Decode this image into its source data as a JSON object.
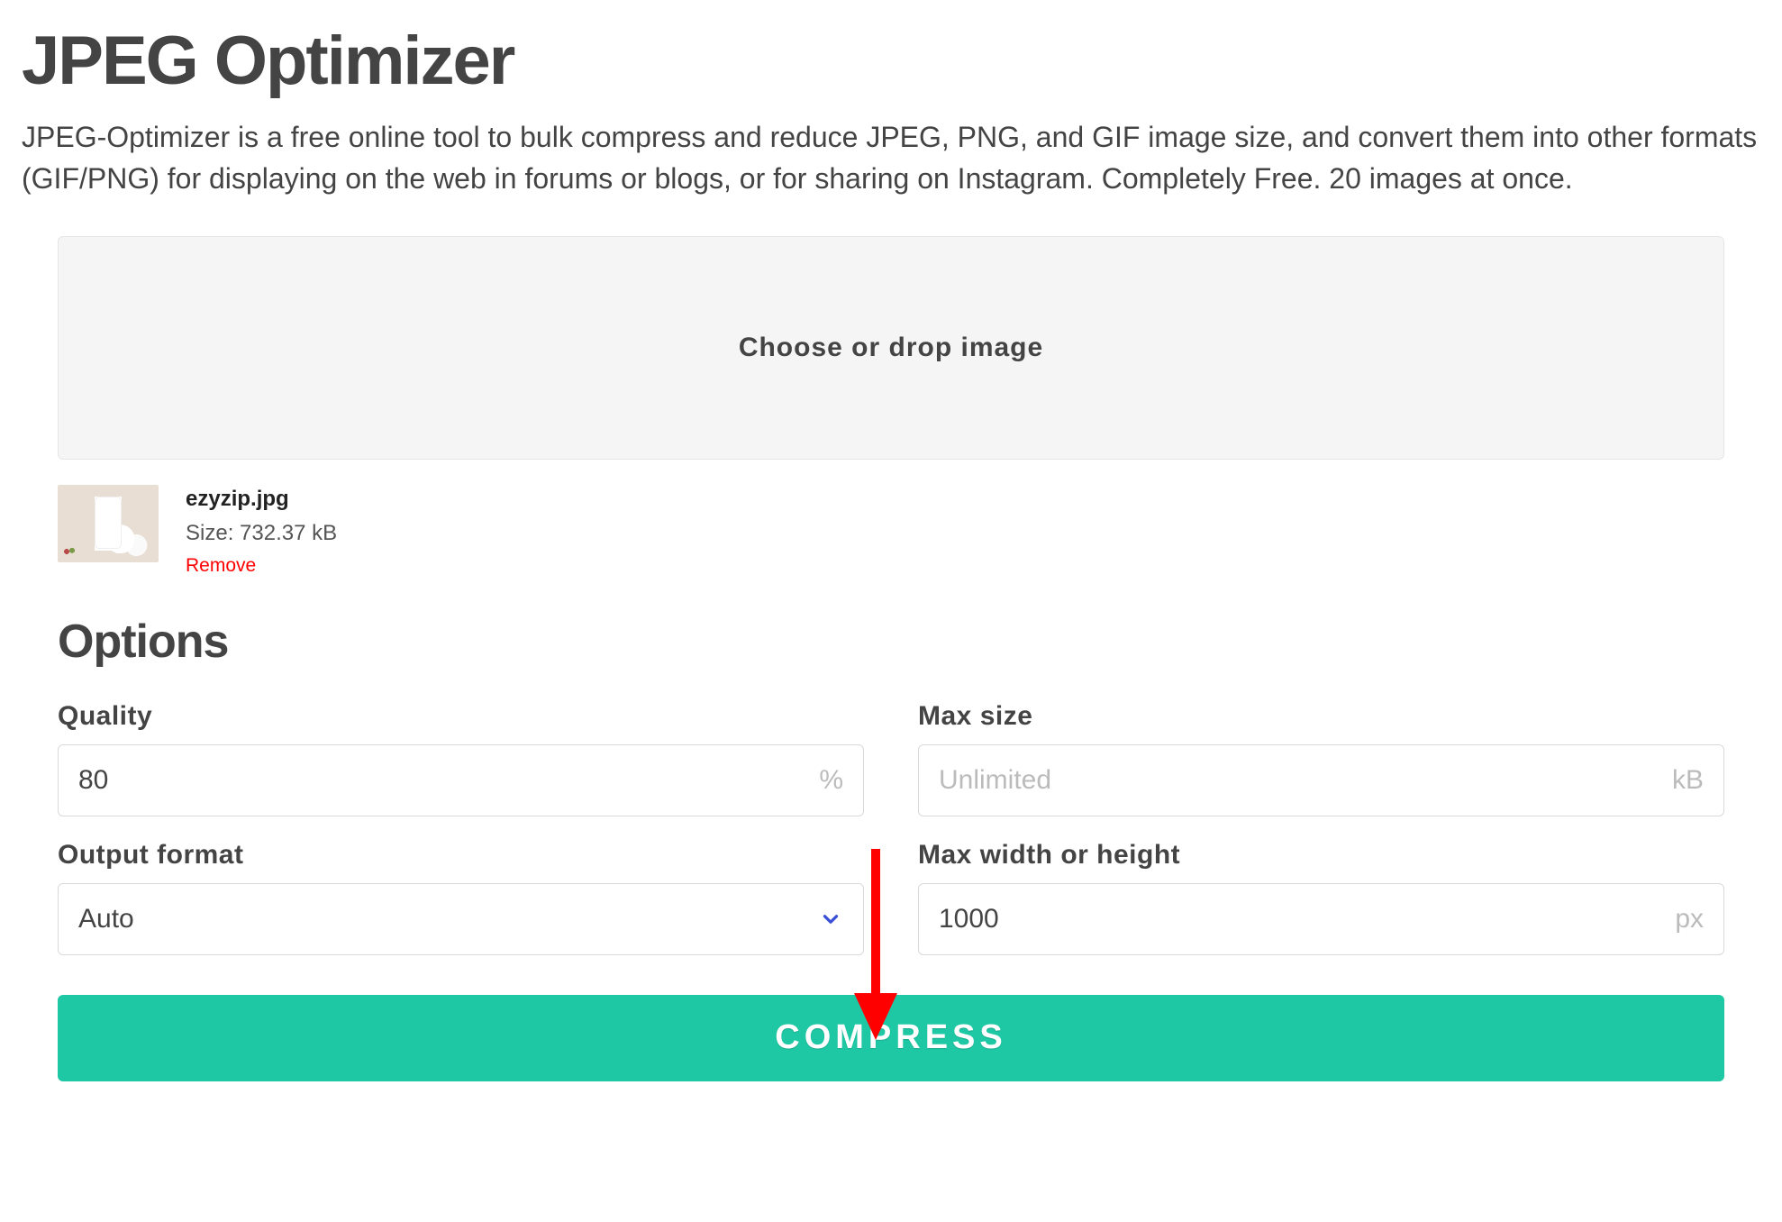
{
  "header": {
    "title": "JPEG Optimizer",
    "subtitle": "JPEG-Optimizer is a free online tool to bulk compress and reduce JPEG, PNG, and GIF image size, and convert them into other formats (GIF/PNG) for displaying on the web in forums or blogs, or for sharing on Instagram. Completely Free. 20 images at once."
  },
  "dropzone": {
    "label": "Choose or drop image"
  },
  "file": {
    "name": "ezyzip.jpg",
    "size_label": "Size: 732.37 kB",
    "remove_label": "Remove"
  },
  "options": {
    "heading": "Options",
    "quality": {
      "label": "Quality",
      "value": "80",
      "suffix": "%"
    },
    "max_size": {
      "label": "Max size",
      "placeholder": "Unlimited",
      "value": "",
      "suffix": "kB"
    },
    "output_format": {
      "label": "Output format",
      "value": "Auto"
    },
    "max_dim": {
      "label": "Max width or height",
      "value": "1000",
      "suffix": "px"
    }
  },
  "actions": {
    "compress_label": "COMPRESS"
  },
  "annotation": {
    "arrow_color": "#ff0000"
  }
}
